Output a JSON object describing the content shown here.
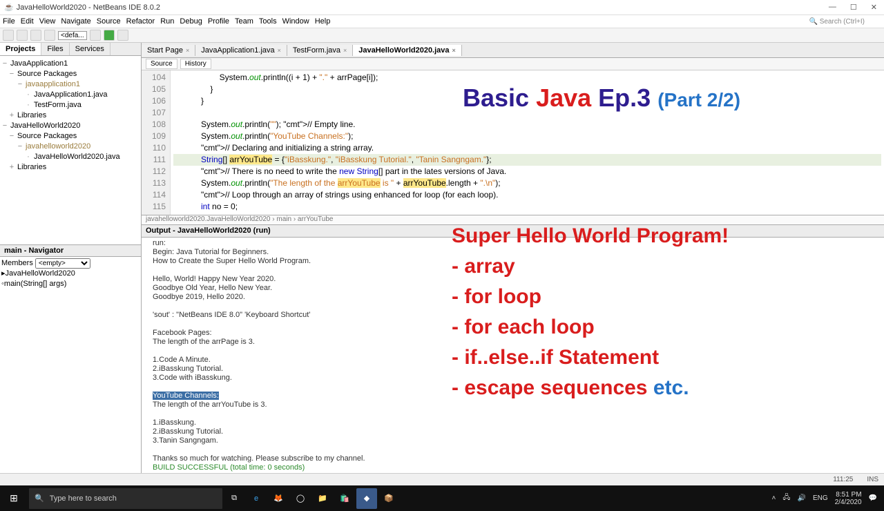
{
  "window": {
    "title": "JavaHelloWorld2020 - NetBeans IDE 8.0.2",
    "searchHint": "Search (Ctrl+I)"
  },
  "menu": [
    "File",
    "Edit",
    "View",
    "Navigate",
    "Source",
    "Refactor",
    "Run",
    "Debug",
    "Profile",
    "Team",
    "Tools",
    "Window",
    "Help"
  ],
  "toolbar": {
    "config": "<defa..."
  },
  "panelTabs": [
    "Projects",
    "Files",
    "Services"
  ],
  "tree": [
    {
      "l": 0,
      "t": "JavaApplication1",
      "exp": "−"
    },
    {
      "l": 1,
      "t": "Source Packages",
      "exp": "−"
    },
    {
      "l": 2,
      "t": "javaapplication1",
      "exp": "−",
      "cls": "pkg"
    },
    {
      "l": 3,
      "t": "JavaApplication1.java"
    },
    {
      "l": 3,
      "t": "TestForm.java"
    },
    {
      "l": 1,
      "t": "Libraries",
      "exp": "+"
    },
    {
      "l": 0,
      "t": "JavaHelloWorld2020",
      "exp": "−"
    },
    {
      "l": 1,
      "t": "Source Packages",
      "exp": "−"
    },
    {
      "l": 2,
      "t": "javahelloworld2020",
      "exp": "−",
      "cls": "pkg"
    },
    {
      "l": 3,
      "t": "JavaHelloWorld2020.java"
    },
    {
      "l": 1,
      "t": "Libraries",
      "exp": "+"
    }
  ],
  "navigator": {
    "title": "main - Navigator",
    "members": "Members",
    "empty": "<empty>",
    "root": "JavaHelloWorld2020",
    "method": "main(String[] args)"
  },
  "fileTabs": [
    {
      "label": "Start Page"
    },
    {
      "label": "JavaApplication1.java"
    },
    {
      "label": "TestForm.java"
    },
    {
      "label": "JavaHelloWorld2020.java",
      "active": true
    }
  ],
  "srcTabs": [
    "Source",
    "History"
  ],
  "breadcrumb": "javahelloworld2020.JavaHelloWorld2020 › main › arrYouTube",
  "code": {
    "start": 104,
    "lines": [
      "                    System.out.println((i + 1) + \".\" + arrPage[i]);",
      "                }",
      "            }",
      "",
      "            System.out.println(\"\"); // Empty line.",
      "            System.out.println(\"YouTube Channels:\");",
      "            // Declaring and initializing a string array.",
      "            String[] arrYouTube = {\"iBasskung.\", \"iBasskung Tutorial.\", \"Tanin Sangngam.\"};",
      "            // There is no need to write the new String[] part in the lates versions of Java.",
      "            System.out.println(\"The length of the arrYouTube is \" + arrYouTube.length + \".\\n\");",
      "            // Loop through an array of strings using enhanced for loop (for each loop).",
      "            int no = 0;"
    ]
  },
  "outputTitle": "Output - JavaHelloWorld2020 (run)",
  "output": [
    "run:",
    "Begin: Java Tutorial for Beginners.",
    "How to Create the Super Hello World Program.",
    "",
    "Hello, World! Happy New Year 2020.",
    "Goodbye Old Year, Hello New Year.",
    "Goodbye 2019, Hello 2020.",
    "",
    "'sout' : \"NetBeans IDE 8.0\" 'Keyboard Shortcut'",
    "",
    "Facebook Pages:",
    "The length of the arrPage is 3.",
    "",
    "1.Code A Minute.",
    "2.iBasskung Tutorial.",
    "3.Code with iBasskung.",
    "",
    "YouTube Channels:",
    "The length of the arrYouTube is 3.",
    "",
    "1.iBasskung.",
    "2.iBasskung Tutorial.",
    "3.Tanin Sangngam.",
    "",
    "Thanks so much for watching. Please subscribe to my channel.",
    "BUILD SUCCESSFUL (total time: 0 seconds)"
  ],
  "outputSelectedIndex": 17,
  "status": {
    "pos": "111:25",
    "mode": "INS"
  },
  "taskbar": {
    "search": "Type here to search",
    "time": "8:51 PM",
    "date": "2/4/2020",
    "lang": "ENG"
  },
  "overlay": {
    "title": {
      "a": "Basic ",
      "b": "Java ",
      "c": "Ep.3 ",
      "d": "(Part 2/2)"
    },
    "heading": "Super Hello World Program!",
    "bullets": [
      "- array",
      "- for loop",
      "- for each loop",
      "- if..else..if Statement"
    ],
    "last": "- escape sequences ",
    "etc": "etc."
  }
}
